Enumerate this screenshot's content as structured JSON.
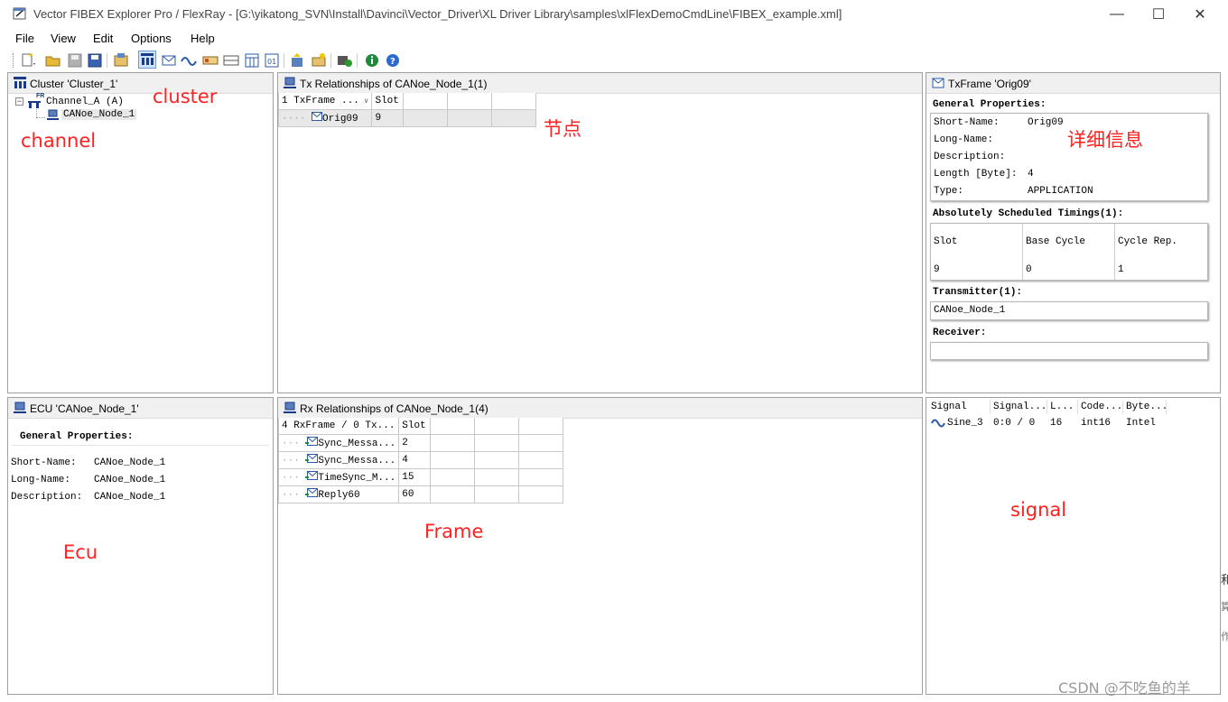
{
  "window": {
    "title": "Vector FIBEX Explorer Pro / FlexRay - [G:\\yikatong_SVN\\Install\\Davinci\\Vector_Driver\\XL Driver Library\\samples\\xlFlexDemoCmdLine\\FIBEX_example.xml]",
    "minimize": "—",
    "maximize": "☐",
    "close": "✕"
  },
  "menu": [
    "File",
    "View",
    "Edit",
    "Options",
    "Help"
  ],
  "toolbar_icons": [
    "new-icon",
    "open-icon",
    "save-gray-icon",
    "save-icon",
    "properties-icon",
    "cluster-view-icon",
    "frame-icon",
    "signal-icon",
    "pdu-icon",
    "table-icon",
    "schedule-icon",
    "coding-icon",
    "import-icon",
    "export-icon",
    "database-icon",
    "info-icon",
    "help-icon"
  ],
  "cluster_pane": {
    "header": "Cluster 'Cluster_1'",
    "channel": "Channel_A (A)",
    "channel_badge": "FR",
    "node": "CANoe_Node_1"
  },
  "tx_pane": {
    "header": "Tx Relationships of CANoe_Node_1(1)",
    "col1": "1 TxFrame ...",
    "col2": "Slot",
    "rows": [
      {
        "name": "Orig09",
        "slot": "9"
      }
    ]
  },
  "detail_pane": {
    "header": "TxFrame 'Orig09'",
    "general_title": "General Properties:",
    "fields": [
      {
        "k": "Short-Name:",
        "v": "Orig09"
      },
      {
        "k": "Long-Name:",
        "v": ""
      },
      {
        "k": "Description:",
        "v": ""
      },
      {
        "k": "Length [Byte]:",
        "v": "4"
      },
      {
        "k": "Type:",
        "v": "APPLICATION"
      }
    ],
    "timings_title": "Absolutely Scheduled Timings(1):",
    "timing_cols": [
      "Slot",
      "Base Cycle",
      "Cycle Rep."
    ],
    "timing_vals": [
      "9",
      "0",
      "1"
    ],
    "transmitter_title": "Transmitter(1):",
    "transmitter": "CANoe_Node_1",
    "receiver_title": "Receiver:"
  },
  "ecu_pane": {
    "header": "ECU 'CANoe_Node_1'",
    "general_title": "General Properties:",
    "fields": [
      {
        "k": "Short-Name:",
        "v": "CANoe_Node_1"
      },
      {
        "k": "Long-Name:",
        "v": "CANoe_Node_1"
      },
      {
        "k": "Description:",
        "v": "CANoe_Node_1"
      }
    ]
  },
  "rx_pane": {
    "header": "Rx Relationships of CANoe_Node_1(4)",
    "col1": "4 RxFrame / 0 Tx...",
    "col2": "Slot",
    "rows": [
      {
        "name": "Sync_Messa...",
        "slot": "2"
      },
      {
        "name": "Sync_Messa...",
        "slot": "4"
      },
      {
        "name": "TimeSync_M...",
        "slot": "15"
      },
      {
        "name": "Reply60",
        "slot": "60"
      }
    ]
  },
  "signal_pane": {
    "cols": [
      "Signal",
      "Signal...",
      "L...",
      "Code...",
      "Byte..."
    ],
    "row": [
      "Sine_3",
      "0:0 / 0",
      "16",
      "int16",
      "Intel"
    ]
  },
  "annotations": {
    "cluster": "cluster",
    "channel": "channel",
    "node": "节点",
    "detail": "详细信息",
    "ecu": "Ecu",
    "frame": "Frame",
    "signal": "signal"
  },
  "watermark": "CSDN @不吃鱼的羊",
  "edge_chars": [
    "和",
    "算",
    "作"
  ]
}
